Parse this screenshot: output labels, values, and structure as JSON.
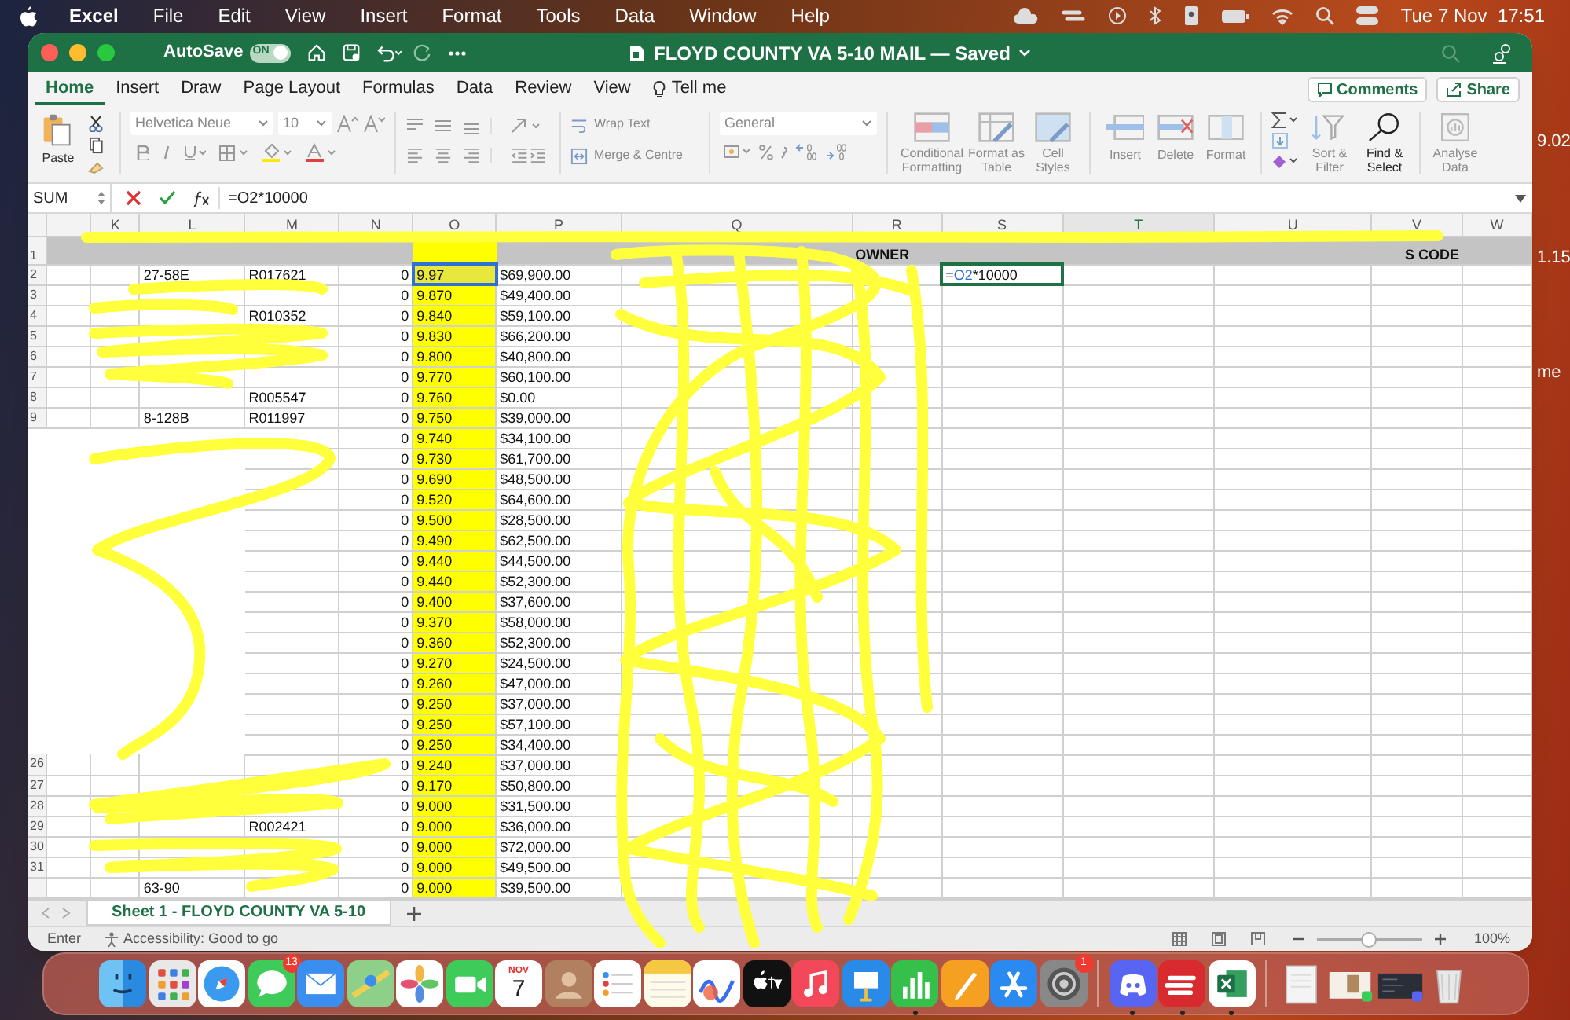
{
  "menu_bar": {
    "app": "Excel",
    "items": [
      "File",
      "Edit",
      "View",
      "Insert",
      "Format",
      "Tools",
      "Data",
      "Window",
      "Help"
    ],
    "clock": "Tue 7 Nov  17:51"
  },
  "title_bar": {
    "autosave_label": "AutoSave",
    "autosave_on": true,
    "toggle_text": "ON",
    "title": "FLOYD COUNTY VA 5-10 MAIL — Saved"
  },
  "ribbon_tabs": [
    {
      "label": "Home",
      "selected": true
    },
    {
      "label": "Insert",
      "selected": false
    },
    {
      "label": "Draw",
      "selected": false
    },
    {
      "label": "Page Layout",
      "selected": false
    },
    {
      "label": "Formulas",
      "selected": false
    },
    {
      "label": "Data",
      "selected": false
    },
    {
      "label": "Review",
      "selected": false
    },
    {
      "label": "View",
      "selected": false
    },
    {
      "label": "Tell me",
      "selected": false,
      "kind": "search"
    }
  ],
  "top_buttons": {
    "comments": "Comments",
    "share": "Share"
  },
  "ribbon": {
    "paste": "Paste",
    "font": "Helvetica Neue",
    "size": "10",
    "wrap_text": "Wrap Text",
    "merge": "Merge & Centre",
    "number_format": "General",
    "styles": [
      "Conditional Formatting",
      "Format as Table",
      "Cell Styles"
    ],
    "cells": [
      "Insert",
      "Delete",
      "Format"
    ],
    "sort": "Sort & Filter",
    "find": "Find & Select",
    "analyse": "Analyse Data"
  },
  "formula_bar": {
    "name_box": "SUM",
    "formula": "=O2*10000"
  },
  "sheet": {
    "columns": [
      {
        "letter": "K",
        "selected": false
      },
      {
        "letter": "L",
        "selected": false
      },
      {
        "letter": "M",
        "selected": false
      },
      {
        "letter": "N",
        "selected": false
      },
      {
        "letter": "O",
        "selected": false
      },
      {
        "letter": "P",
        "selected": false
      },
      {
        "letter": "Q",
        "selected": false
      },
      {
        "letter": "R",
        "selected": false
      },
      {
        "letter": "S",
        "selected": false
      },
      {
        "letter": "T",
        "selected": true
      },
      {
        "letter": "U",
        "selected": false
      },
      {
        "letter": "V",
        "selected": false
      },
      {
        "letter": "W",
        "selected": false
      }
    ],
    "header_row": {
      "num": "1",
      "R": "OWNER",
      "V": "S CODE"
    },
    "rows": [
      {
        "num": "2",
        "L": "27-58E",
        "M": "R017621",
        "N": "0",
        "O": "9.97",
        "P": "$69,900.00",
        "selected": true
      },
      {
        "num": "3",
        "N": "0",
        "O": "9.870",
        "P": "$49,400.00",
        "selected": false
      },
      {
        "num": "4",
        "M": "R010352",
        "N": "0",
        "O": "9.840",
        "P": "$59,100.00",
        "selected": false
      },
      {
        "num": "5",
        "N": "0",
        "O": "9.830",
        "P": "$66,200.00",
        "selected": false
      },
      {
        "num": "6",
        "N": "0",
        "O": "9.800",
        "P": "$40,800.00",
        "selected": false
      },
      {
        "num": "7",
        "N": "0",
        "O": "9.770",
        "P": "$60,100.00",
        "selected": false
      },
      {
        "num": "8",
        "M": "R005547",
        "N": "0",
        "O": "9.760",
        "P": "$0.00",
        "selected": false
      },
      {
        "num": "9",
        "L": "8-128B",
        "M": "R011997",
        "N": "0",
        "O": "9.750",
        "P": "$39,000.00",
        "selected": false
      },
      {
        "N": "0",
        "O": "9.740",
        "P": "$34,100.00",
        "selected": false
      },
      {
        "N": "0",
        "O": "9.730",
        "P": "$61,700.00",
        "selected": false
      },
      {
        "N": "0",
        "O": "9.690",
        "P": "$48,500.00",
        "selected": false
      },
      {
        "N": "0",
        "O": "9.520",
        "P": "$64,600.00",
        "selected": false
      },
      {
        "N": "0",
        "O": "9.500",
        "P": "$28,500.00",
        "selected": false
      },
      {
        "N": "0",
        "O": "9.490",
        "P": "$62,500.00",
        "selected": false
      },
      {
        "N": "0",
        "O": "9.440",
        "P": "$44,500.00",
        "selected": false
      },
      {
        "N": "0",
        "O": "9.440",
        "P": "$52,300.00",
        "selected": false
      },
      {
        "N": "0",
        "O": "9.400",
        "P": "$37,600.00",
        "selected": false
      },
      {
        "N": "0",
        "O": "9.370",
        "P": "$58,000.00",
        "selected": false
      },
      {
        "N": "0",
        "O": "9.360",
        "P": "$52,300.00",
        "selected": false
      },
      {
        "N": "0",
        "O": "9.270",
        "P": "$24,500.00",
        "selected": false
      },
      {
        "N": "0",
        "O": "9.260",
        "P": "$47,000.00",
        "selected": false
      },
      {
        "N": "0",
        "O": "9.250",
        "P": "$37,000.00",
        "selected": false
      },
      {
        "N": "0",
        "O": "9.250",
        "P": "$57,100.00",
        "selected": false
      },
      {
        "N": "0",
        "O": "9.250",
        "P": "$34,400.00",
        "selected": false
      },
      {
        "num": "26",
        "N": "0",
        "O": "9.240",
        "P": "$37,000.00",
        "selected": false
      },
      {
        "num": "27",
        "N": "0",
        "O": "9.170",
        "P": "$50,800.00",
        "selected": false
      },
      {
        "num": "28",
        "N": "0",
        "O": "9.000",
        "P": "$31,500.00",
        "selected": false
      },
      {
        "num": "29",
        "M": "R002421",
        "N": "0",
        "O": "9.000",
        "P": "$36,000.00",
        "selected": false
      },
      {
        "num": "30",
        "N": "0",
        "O": "9.000",
        "P": "$72,000.00",
        "selected": false
      },
      {
        "num": "31",
        "N": "0",
        "O": "9.000",
        "P": "$49,500.00",
        "selected": false
      },
      {
        "L": "63-90",
        "N": "0",
        "O": "9.000",
        "P": "$39,500.00",
        "selected": false
      }
    ],
    "edit_cell": {
      "prefix": "=",
      "ref": "O2",
      "rest": "*10000"
    }
  },
  "sheet_tabs": [
    {
      "label": "Sheet 1 - FLOYD COUNTY VA 5-10",
      "selected": true
    }
  ],
  "status_bar": {
    "mode": "Enter",
    "accessibility": "Accessibility: Good to go",
    "zoom": "100%",
    "level": 0.5
  },
  "desktop_fragments": [
    "9.02",
    "1.15",
    "me"
  ],
  "dock": [
    {
      "kind": "finder",
      "running": false
    },
    {
      "kind": "launchpad",
      "running": false
    },
    {
      "kind": "safari",
      "running": false
    },
    {
      "kind": "messages",
      "running": false,
      "badge": "13"
    },
    {
      "kind": "mail",
      "running": false
    },
    {
      "kind": "maps",
      "running": false
    },
    {
      "kind": "photos",
      "running": false
    },
    {
      "kind": "facetime",
      "running": false
    },
    {
      "kind": "calendar",
      "running": false,
      "month": "NOV",
      "day": "7"
    },
    {
      "kind": "contacts",
      "running": false
    },
    {
      "kind": "reminders",
      "running": false
    },
    {
      "kind": "notes",
      "running": false
    },
    {
      "kind": "freeform",
      "running": false
    },
    {
      "kind": "tv",
      "running": false
    },
    {
      "kind": "music",
      "running": false
    },
    {
      "kind": "keynote",
      "running": false
    },
    {
      "kind": "numbers",
      "running": true
    },
    {
      "kind": "pages",
      "running": false
    },
    {
      "kind": "appstore",
      "running": false
    },
    {
      "kind": "settings",
      "running": false,
      "badge": "1"
    },
    {
      "kind": "divider"
    },
    {
      "kind": "discord",
      "running": true
    },
    {
      "kind": "vpn",
      "running": true
    },
    {
      "kind": "excel",
      "running": true
    },
    {
      "kind": "divider"
    },
    {
      "kind": "document",
      "running": false
    },
    {
      "kind": "photo-thumb",
      "running": false
    },
    {
      "kind": "screen-thumb",
      "running": false
    },
    {
      "kind": "trash",
      "running": false
    }
  ]
}
